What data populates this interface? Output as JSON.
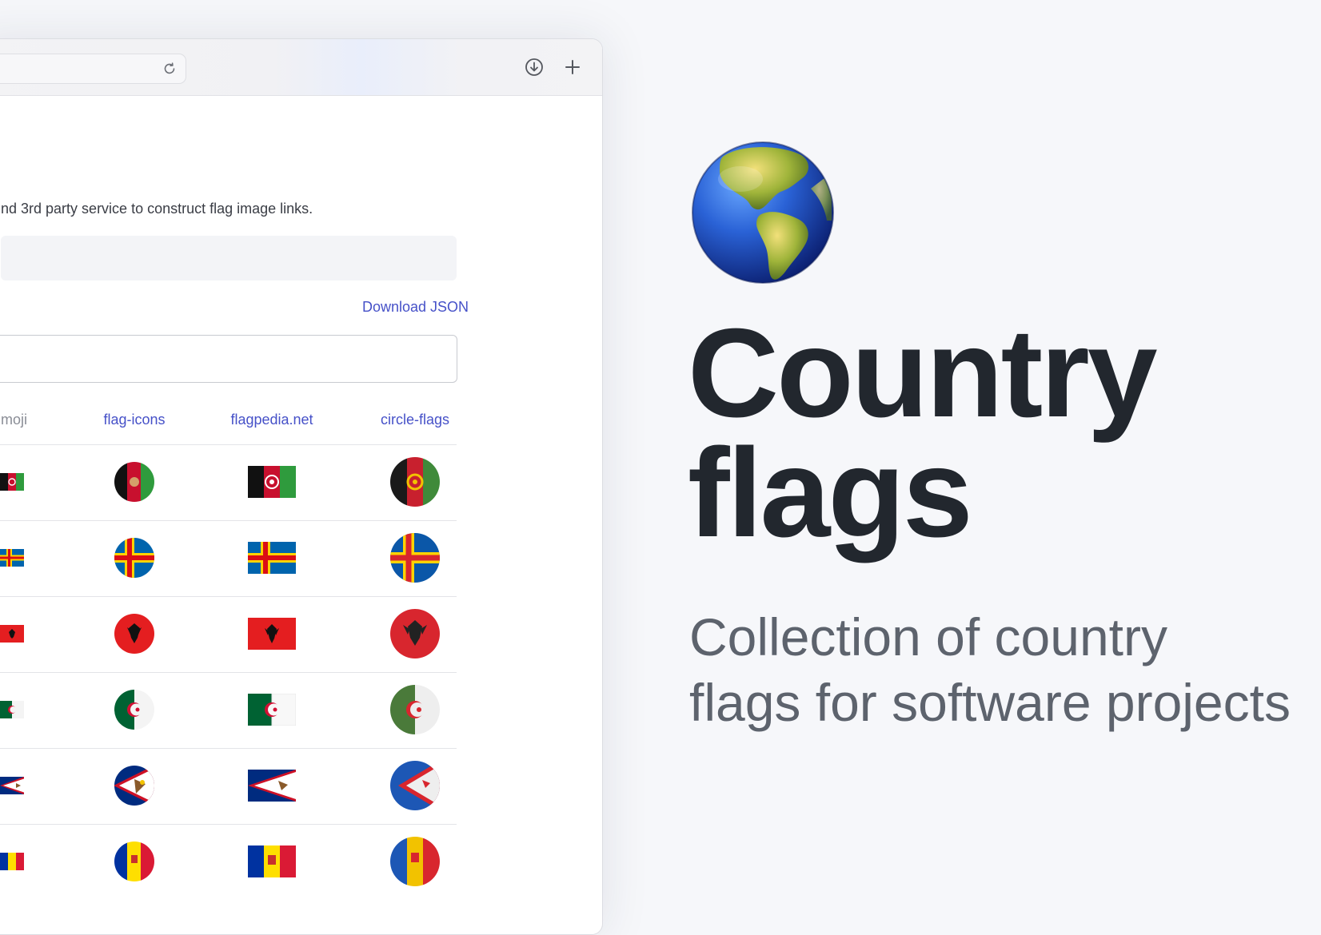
{
  "page": {
    "description_text": "nd 3rd party service to construct flag image links.",
    "download_link": "Download JSON",
    "columns": [
      "moji",
      "flag-icons",
      "flagpedia.net",
      "circle-flags"
    ]
  },
  "flag_rows": [
    {
      "country": "afghanistan"
    },
    {
      "country": "aland-islands"
    },
    {
      "country": "albania"
    },
    {
      "country": "algeria"
    },
    {
      "country": "american-samoa"
    },
    {
      "country": "andorra"
    }
  ],
  "hero": {
    "title_line1": "Country",
    "title_line2": "flags",
    "subtitle_line1": "Collection of country",
    "subtitle_line2": "flags for software projects"
  },
  "colors": {
    "link": "#4651c8",
    "title": "#22272e",
    "subtitle": "#5d636d"
  }
}
